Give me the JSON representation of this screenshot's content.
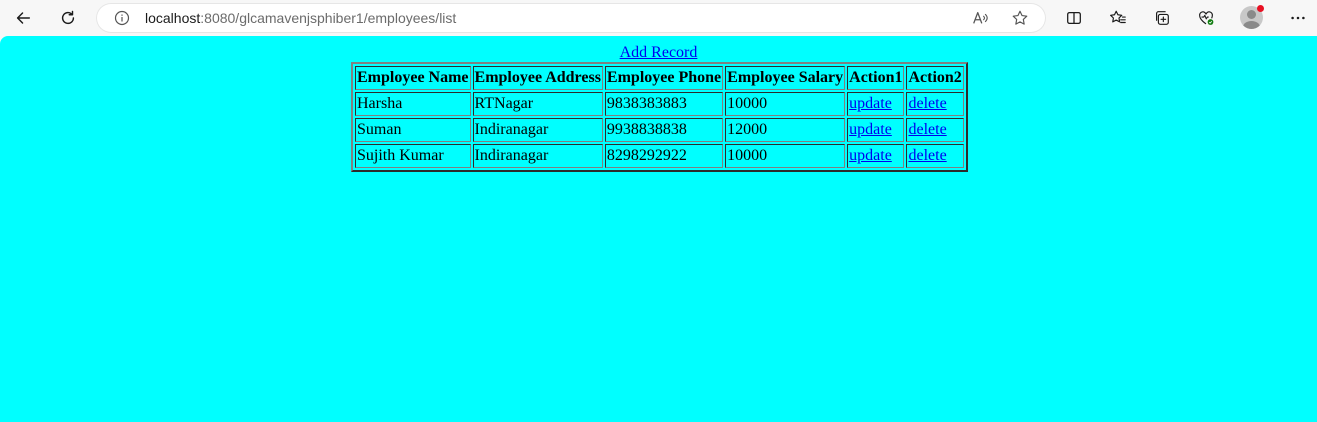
{
  "browser": {
    "url_host": "localhost",
    "url_path": ":8080/glcamavenjsphiber1/employees/list",
    "icons": [
      "back-icon",
      "refresh-icon",
      "info-icon",
      "read-aloud-icon",
      "favorite-star-icon",
      "split-screen-icon",
      "favorites-icon",
      "collections-icon",
      "performance-icon",
      "profile-avatar",
      "more-icon"
    ]
  },
  "page": {
    "add_record": "Add Record",
    "background": "#00ffff",
    "link_color": "#0000ee",
    "table": {
      "headers": [
        "Employee Name",
        "Employee Address",
        "Employee Phone",
        "Employee Salary",
        "Action1",
        "Action2"
      ],
      "rows": [
        {
          "name": "Harsha",
          "address": "RTNagar",
          "phone": "9838383883",
          "salary": "10000",
          "action1": "update",
          "action2": "delete"
        },
        {
          "name": "Suman",
          "address": "Indiranagar",
          "phone": "9938838838",
          "salary": "12000",
          "action1": "update",
          "action2": "delete"
        },
        {
          "name": "Sujith Kumar",
          "address": "Indiranagar",
          "phone": "8298292922",
          "salary": "10000",
          "action1": "update",
          "action2": "delete"
        }
      ]
    }
  }
}
